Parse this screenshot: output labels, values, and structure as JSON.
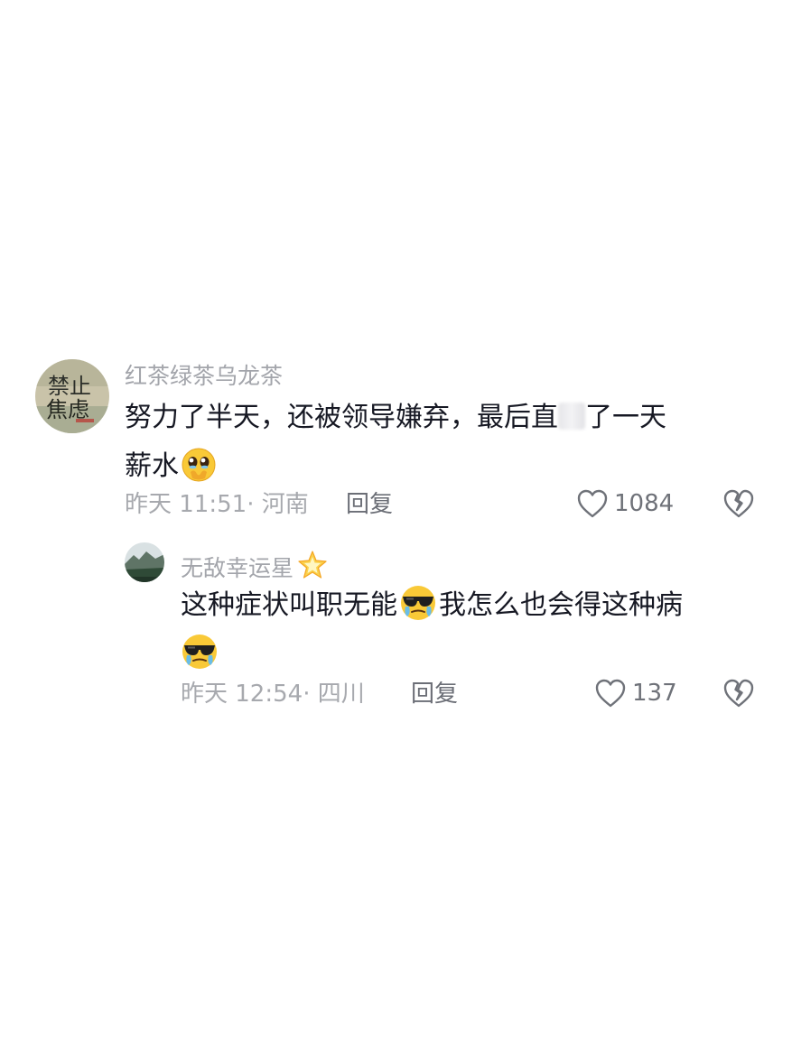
{
  "comments": [
    {
      "username": "红茶绿茶乌龙茶",
      "avatar_icon": "avatar-photo",
      "text_line1_a": "努力了半天，还被领导嫌弃，最后直",
      "text_line1_b": "了一天",
      "text_line2": "薪水",
      "inline_emoji": "pleading-face-emoji",
      "time": "昨天 11:51",
      "location_sep": "·",
      "location": "河南",
      "reply_label": "回复",
      "like_count": "1084"
    },
    {
      "username": "无敌幸运星",
      "name_emoji": "glowing-star-emoji",
      "avatar_icon": "avatar-landscape",
      "text_part1": "这种症状叫职无能",
      "text_part2": "我怎么也会得这种病",
      "inline_emoji": "crying-sunglasses-emoji",
      "time": "昨天 12:54",
      "location_sep": "·",
      "location": "四川",
      "reply_label": "回复",
      "like_count": "137"
    }
  ],
  "colors": {
    "text_primary": "#161823",
    "text_secondary": "#a3a5ab",
    "reply": "#6b6e76",
    "background": "#ffffff"
  }
}
